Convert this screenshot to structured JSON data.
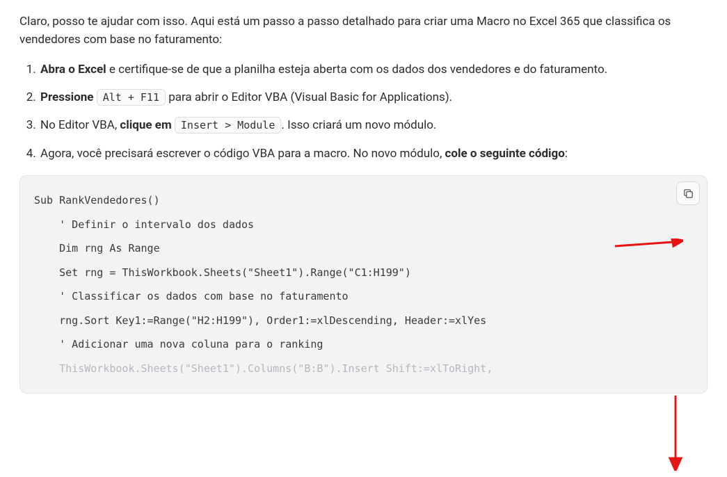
{
  "intro": "Claro, posso te ajudar com isso. Aqui está um passo a passo detalhado para criar uma Macro no Excel 365 que classifica os vendedores com base no faturamento:",
  "steps": {
    "s1a": "Abra o Excel",
    "s1b": " e certifique-se de que a planilha esteja aberta com os dados dos vendedores e do faturamento.",
    "s2a": "Pressione",
    "s2code": "Alt + F11",
    "s2b": " para abrir o Editor VBA (Visual Basic for Applications).",
    "s3a": "No Editor VBA, ",
    "s3b": "clique em",
    "s3code": "Insert > Module",
    "s3c": ". Isso criará um novo módulo.",
    "s4a": "Agora, você precisará escrever o código VBA para a macro. No novo módulo, ",
    "s4b": "cole o seguinte código",
    "s4c": ":"
  },
  "code": {
    "l1": "Sub RankVendedores()",
    "l2": "    ' Definir o intervalo dos dados",
    "l3": "    Dim rng As Range",
    "l4": "    Set rng = ThisWorkbook.Sheets(\"Sheet1\").Range(\"C1:H199\")",
    "l5": "",
    "l6": "    ' Classificar os dados com base no faturamento",
    "l7": "    rng.Sort Key1:=Range(\"H2:H199\"), Order1:=xlDescending, Header:=xlYes",
    "l8": "",
    "l9": "    ' Adicionar uma nova coluna para o ranking",
    "l10": "    ThisWorkbook.Sheets(\"Sheet1\").Columns(\"B:B\").Insert Shift:=xlToRight,"
  },
  "icons": {
    "copy": "copy-icon"
  }
}
